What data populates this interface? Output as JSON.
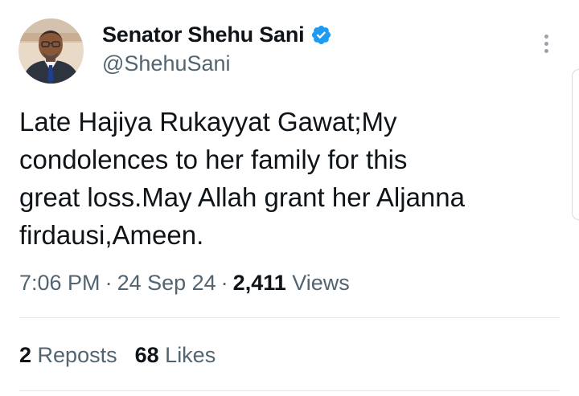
{
  "tweet": {
    "author": {
      "display_name": "Senator Shehu Sani",
      "handle": "@ShehuSani",
      "verified": true
    },
    "text": "Late Hajiya Rukayyat Gawat;My\ncondolences to her family for this\ngreat loss.May Allah grant her Aljanna\nfirdausi,Ameen.",
    "time": "7:06 PM",
    "date": "24 Sep 24",
    "separator": "·",
    "views_count": "2,411",
    "views_label": "Views",
    "reposts_count": "2",
    "reposts_label": "Reposts",
    "likes_count": "68",
    "likes_label": "Likes"
  },
  "colors": {
    "text_primary": "#0f1419",
    "text_secondary": "#536471",
    "verified_blue": "#1d9bf0",
    "divider": "#e3e7ea"
  },
  "icons": {
    "verified": "verified-badge-icon",
    "more": "more-vertical-icon"
  }
}
